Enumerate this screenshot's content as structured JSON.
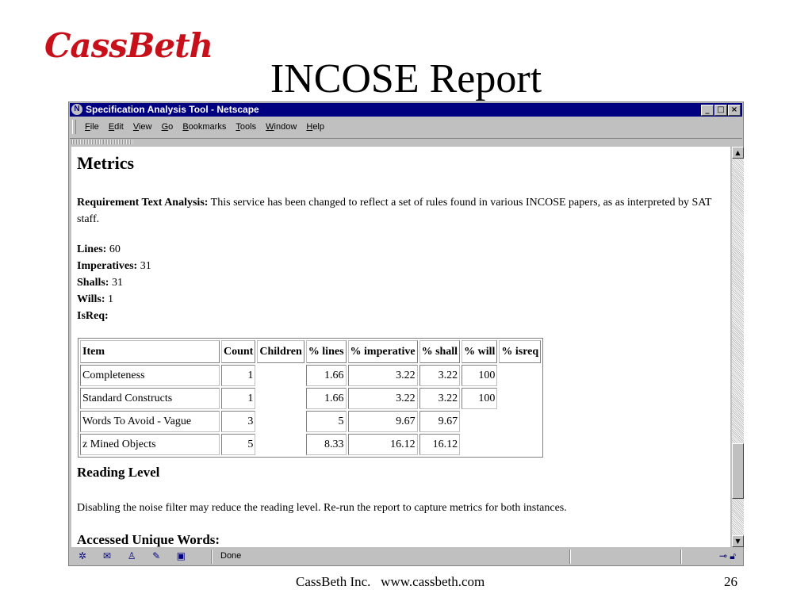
{
  "slide": {
    "logo": "CassBeth",
    "title": "INCOSE Report",
    "footer": "CassBeth Inc.   www.cassbeth.com",
    "page_number": "26"
  },
  "window": {
    "title": "Specification Analysis Tool - Netscape",
    "controls": {
      "minimize": "_",
      "maximize": "□",
      "close": "×"
    }
  },
  "menu": [
    "File",
    "Edit",
    "View",
    "Go",
    "Bookmarks",
    "Tools",
    "Window",
    "Help"
  ],
  "content": {
    "heading": "Metrics",
    "rta_label": "Requirement Text Analysis:",
    "rta_text": " This service has been changed to reflect a set of rules found in various INCOSE papers, as as interpreted by SAT staff.",
    "stats": [
      {
        "label": "Lines:",
        "value": " 60"
      },
      {
        "label": "Imperatives:",
        "value": " 31"
      },
      {
        "label": "Shalls:",
        "value": " 31"
      },
      {
        "label": "Wills:",
        "value": " 1"
      },
      {
        "label": "IsReq:",
        "value": ""
      }
    ],
    "table": {
      "headers": [
        "Item",
        "Count",
        "Children",
        "% lines",
        "% imperative",
        "% shall",
        "% will",
        "% isreq"
      ],
      "rows": [
        [
          "Completeness",
          "1",
          "",
          "1.66",
          "3.22",
          "3.22",
          "100",
          ""
        ],
        [
          "Standard Constructs",
          "1",
          "",
          "1.66",
          "3.22",
          "3.22",
          "100",
          ""
        ],
        [
          "Words To Avoid - Vague",
          "3",
          "",
          "5",
          "9.67",
          "9.67",
          "",
          ""
        ],
        [
          "z Mined Objects",
          "5",
          "",
          "8.33",
          "16.12",
          "16.12",
          "",
          ""
        ]
      ]
    },
    "reading_heading": "Reading Level",
    "reading_text": "Disabling the noise filter may reduce the reading level. Re-run the report to capture metrics for both instances.",
    "accessed_heading": "Accessed Unique Words:"
  },
  "status": {
    "text": "Done",
    "icons": [
      "navigator-icon",
      "mail-icon",
      "composer-icon",
      "edit-icon",
      "calendar-icon"
    ],
    "security_icons": [
      "online-icon",
      "lock-icon"
    ]
  }
}
